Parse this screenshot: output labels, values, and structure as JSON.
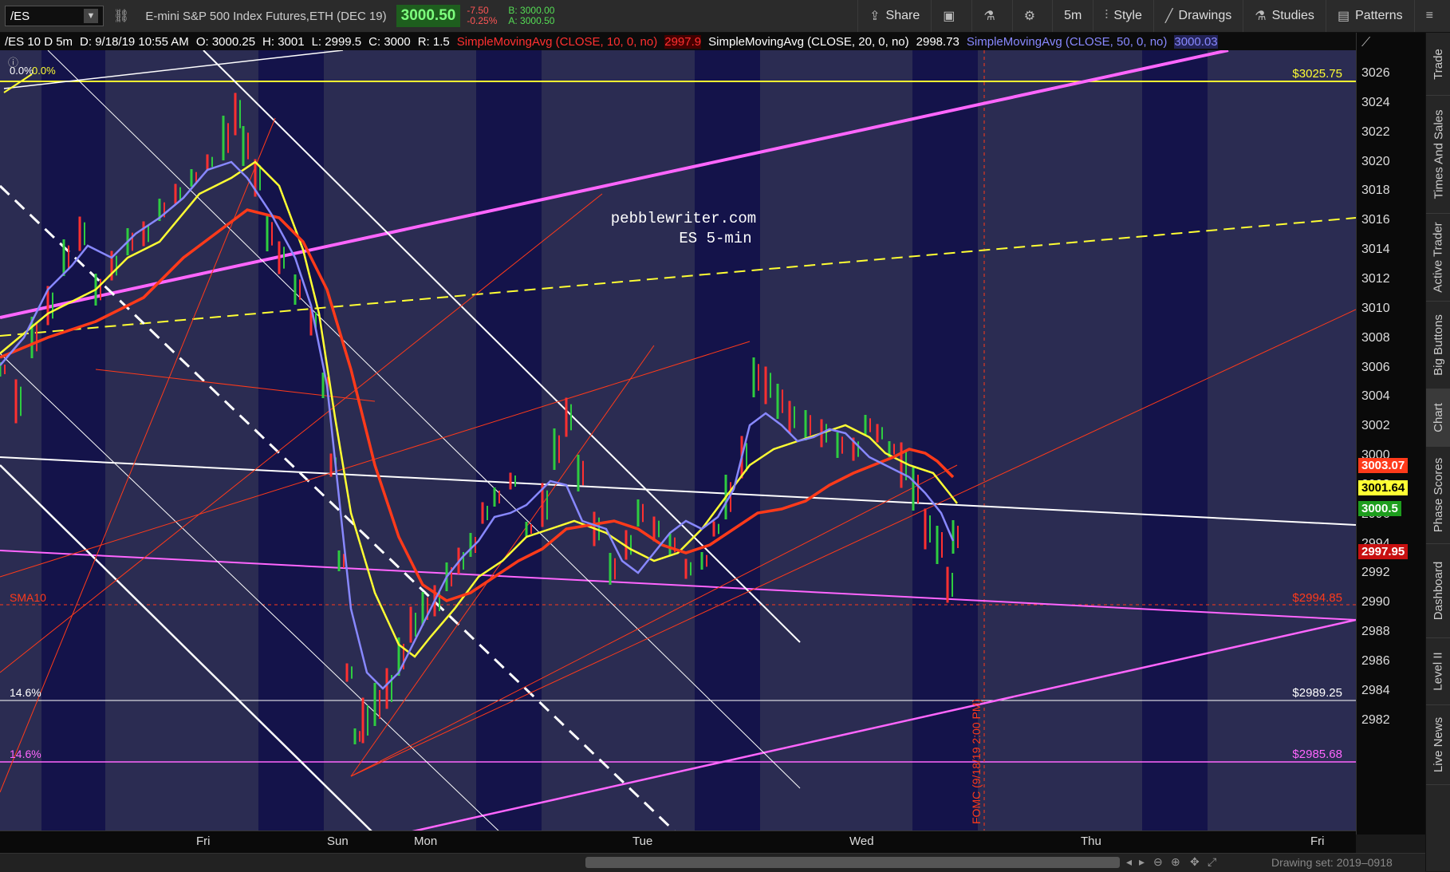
{
  "toolbar": {
    "symbol": "/ES",
    "instrument": "E-mini S&P 500 Index Futures,ETH (DEC 19)",
    "last_price": "3000.50",
    "change": "-7.50",
    "change_pct": "-0.25%",
    "bid": "B: 3000.00",
    "ask": "A: 3000.50",
    "share": "Share",
    "timeframe": "5m",
    "style": "Style",
    "drawings": "Drawings",
    "studies": "Studies",
    "patterns": "Patterns"
  },
  "infobar": {
    "symbol": "/ES 10 D 5m",
    "date": "D: 9/18/19 10:55 AM",
    "open": "O: 3000.25",
    "high": "H: 3001",
    "low": "L: 2999.5",
    "close": "C: 3000",
    "range": "R: 1.5",
    "sma10": "SimpleMovingAvg (CLOSE, 10, 0, no)",
    "sma10_val": "2997.9",
    "sma20": "SimpleMovingAvg (CLOSE, 20, 0, no)",
    "sma20_val": "2998.73",
    "sma50": "SimpleMovingAvg (CLOSE, 50, 0, no)",
    "sma50_val": "3000.03"
  },
  "chart": {
    "watermark_line1": "pebblewriter.com",
    "watermark_line2": "ES 5-min",
    "fib_top_left": "0.0%",
    "fib_top_left2": "0.0%",
    "level_3025": "$3025.75",
    "level_2994": "$2994.85",
    "level_2989": "$2989.25",
    "level_2985": "$2985.68",
    "sma10_label": "SMA10",
    "fib_146_a": "14.6%",
    "fib_146_b": "14.6%",
    "fomc": "FOMC (9/18/19 2:00 PM)"
  },
  "price_axis": {
    "ticks": [
      "3026",
      "3024",
      "3022",
      "3020",
      "3018",
      "3016",
      "3014",
      "3012",
      "3010",
      "3008",
      "3006",
      "3004",
      "3002",
      "3000",
      "2998",
      "2996",
      "2994",
      "2992",
      "2990",
      "2988",
      "2986",
      "2984",
      "2982"
    ],
    "tag_red": "3003.07",
    "tag_yellow": "3001.64",
    "tag_green": "3000.5",
    "tag_darkred": "2997.95"
  },
  "time_axis": [
    "Fri",
    "Sun",
    "Mon",
    "Tue",
    "Wed",
    "Thu",
    "Fri"
  ],
  "status": {
    "drawing_set": "Drawing set: 2019–0918"
  },
  "sidebar": [
    "Trade",
    "Times And Sales",
    "Active Trader",
    "Big Buttons",
    "Chart",
    "Phase Scores",
    "Dashboard",
    "Level II",
    "Live News"
  ],
  "colors": {
    "bg_dark": "#14134a",
    "bg_light": "#2b2c52",
    "magenta": "#ff66ff",
    "yellow": "#ffff33",
    "red": "#ff3a1a",
    "blue": "#8888ff"
  }
}
